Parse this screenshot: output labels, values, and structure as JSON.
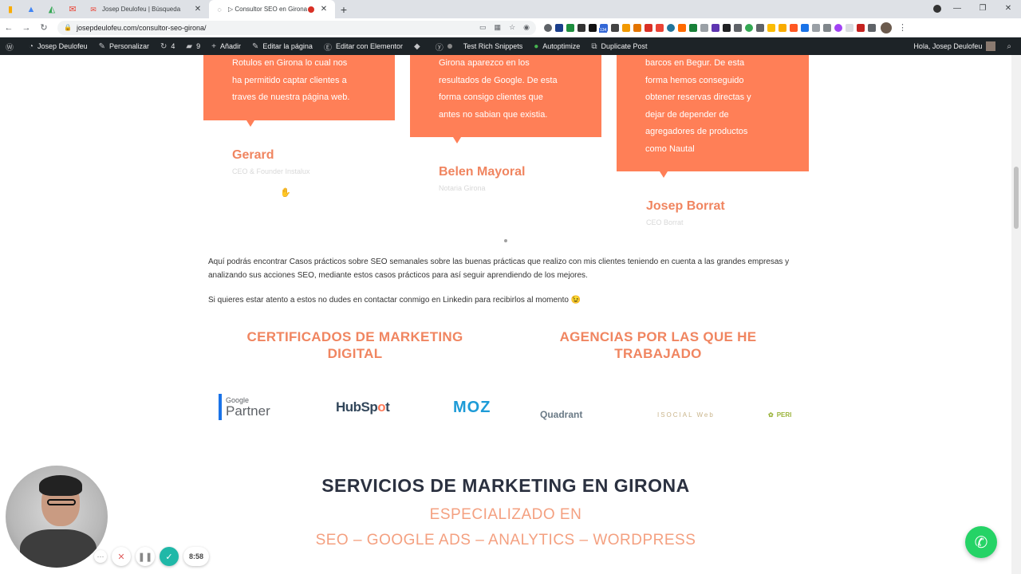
{
  "browser": {
    "pinned_tabs": [
      {
        "icon": "analytics-icon",
        "glyph": "▮",
        "color": "#f9ab00"
      },
      {
        "icon": "google-ads-icon",
        "glyph": "▲",
        "color": "#4285f4"
      },
      {
        "icon": "google-drive-icon",
        "glyph": "◭",
        "color": "#34a853"
      },
      {
        "icon": "gmail-icon",
        "glyph": "✉",
        "color": "#ea4335"
      }
    ],
    "tabs": [
      {
        "title": "Josep Deulofeu | Búsqueda",
        "favicon": "✉",
        "favicon_color": "#ea4335",
        "close": "✕"
      },
      {
        "title": "▷ Consultor SEO en Girona |",
        "favicon": "◌",
        "favicon_color": "#5f6368",
        "close": "✕"
      }
    ],
    "new_tab": "+",
    "url": "josepdeulofeu.com/consultor-seo-girona/",
    "ext_badge": "134"
  },
  "adminbar": {
    "site_name": "Josep Deulofeu",
    "customize": "Personalizar",
    "updates": "4",
    "comments": "9",
    "add_new": "Añadir",
    "edit_page": "Editar la página",
    "edit_elementor": "Editar con Elementor",
    "test_rich": "Test Rich Snippets",
    "autoptimize": "Autoptimize",
    "duplicate_post": "Duplicate Post",
    "greeting": "Hola, Josep Deulofeu"
  },
  "testimonials": [
    {
      "lines": [
        "Rotulos en Girona lo cual nos",
        "ha permitido captar clientes a",
        "traves de nuestra página web."
      ],
      "name": "Gerard",
      "role": "CEO & Founder Instalux"
    },
    {
      "lines": [
        "Girona aparezco en los",
        "resultados de Google. De esta",
        "forma consigo clientes que",
        "antes no sabian que existia."
      ],
      "name": "Belen Mayoral",
      "role": "Notaria Girona"
    },
    {
      "lines": [
        "barcos en Begur. De esta",
        "forma hemos conseguido",
        "obtener reservas directas y",
        "dejar de depender de",
        "agregadores de productos",
        "como Nautal"
      ],
      "name": "Josep Borrat",
      "role": "CEO Borrat"
    }
  ],
  "intro": {
    "p1": "Aquí podrás encontrar Casos prácticos sobre SEO semanales sobre las buenas prácticas que realizo con mis clientes teniendo en cuenta a las grandes empresas y analizando sus acciones SEO, mediante estos casos prácticos para así seguir aprendiendo de los mejores.",
    "p2": "Si quieres estar atento a estos no dudes en contactar conmigo en Linkedin para recibirlos al momento 😉"
  },
  "headings": {
    "certs": "CERTIFICADOS DE MARKETING DIGITAL",
    "agencies": "AGENCIAS POR LAS QUE HE TRABAJADO"
  },
  "logos": {
    "google_small": "Google",
    "google_big": "Partner",
    "hubspot_a": "HubSp",
    "hubspot_o": "o",
    "hubspot_b": "t",
    "moz": "MOZ",
    "quadrant": "Quadrant",
    "social": "ISOCIAL Web",
    "peri": "PERI"
  },
  "services": {
    "title": "SERVICIOS DE MARKETING EN GIRONA",
    "sub1": "ESPECIALIZADO EN",
    "sub2": "SEO – GOOGLE ADS – ANALYTICS – WORDPRESS"
  },
  "recorder": {
    "time": "8:58"
  },
  "colors": {
    "accent": "#ff7f57",
    "heading_orange": "#f08560",
    "dark_heading": "#2b3140",
    "admin_bar": "#1d2327",
    "whatsapp": "#25d366"
  }
}
